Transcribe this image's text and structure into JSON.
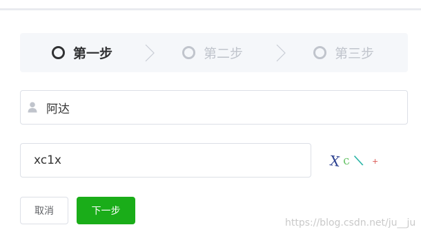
{
  "steps": [
    {
      "label": "第一步",
      "state": "active"
    },
    {
      "label": "第二步",
      "state": "inactive"
    },
    {
      "label": "第三步",
      "state": "inactive"
    }
  ],
  "username": {
    "value": "阿达",
    "icon": "user-icon"
  },
  "captcha": {
    "value": "xc1x",
    "image_chars": [
      "X",
      "c",
      "\\",
      "+"
    ]
  },
  "buttons": {
    "cancel": "取消",
    "next": "下一步"
  },
  "watermark": "https://blog.csdn.net/ju__ju",
  "colors": {
    "primary": "#1aad19",
    "step_active": "#303133",
    "step_inactive": "#c0c4cc",
    "steps_bg": "#f5f7fa"
  }
}
